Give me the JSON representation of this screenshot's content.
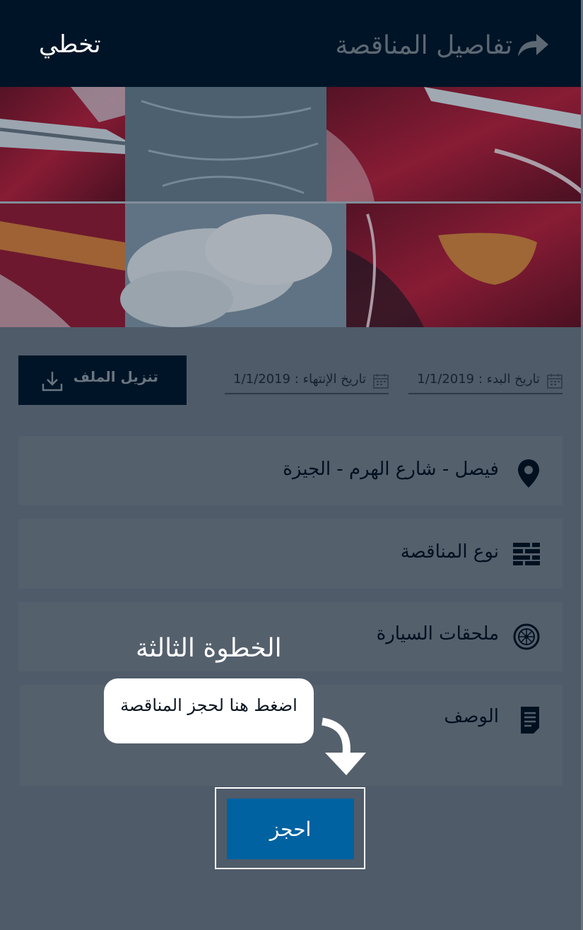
{
  "header": {
    "title": "تفاصيل المناقصة",
    "skip_label": "تخطي",
    "back_icon": "share-arrow-icon"
  },
  "hero": {
    "image": "red-car-collage"
  },
  "dates": {
    "start": "تاريخ البدء : 1/1/2019",
    "end": "تاريخ الإنتهاء : 1/1/2019",
    "icon": "calendar-icon"
  },
  "download": {
    "label": "تنزيل الملف",
    "icon": "download-icon"
  },
  "details": {
    "location": "فيصل - شارع الهرم - الجيزة",
    "tender_type": "نوع المناقصة",
    "accessories": "ملحقات السيارة",
    "description": "الوصف"
  },
  "tutorial": {
    "step_title": "الخطوة الثالثة",
    "hint": "اضغط هنا لحجز المناقصة"
  },
  "book": {
    "label": "احجز"
  },
  "colors": {
    "header_bg": "#001427",
    "overlay": "#4f5b69",
    "accent": "#0062a1"
  }
}
